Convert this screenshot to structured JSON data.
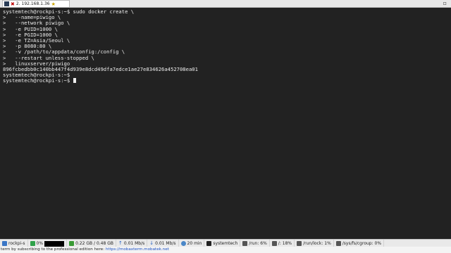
{
  "tab": {
    "label": "2. 192.168.1.36",
    "close_glyph": "✖",
    "star_glyph": "★",
    "window_glyph": "▫"
  },
  "terminal": {
    "lines": [
      "systemtech@rockpi-s:~$ sudo docker create \\",
      ">   --name=piwigo \\",
      ">   --network piwigo \\",
      ">   -e PUID=1000 \\",
      ">   -e PGID=1000 \\",
      ">   -e TZ=Asia/Seoul \\",
      ">   -p 8080:80 \\",
      ">   -v /path/to/appdata/config:/config \\",
      ">   --restart unless-stopped \\",
      ">   linuxserver/piwigo",
      "896fcbedbb0c140bb447f4d939e8dcd49dfa7edce1ae27e834626a452708ea01",
      "systemtech@rockpi-s:~$",
      "systemtech@rockpi-s:~$ "
    ]
  },
  "statusbar": {
    "host": "rockpi-s",
    "cpu": "0%",
    "memory": "0.22 GB / 0.48 GB",
    "upload": "0.01 Mb/s",
    "download": "0.01 Mb/s",
    "uptime": "20 min",
    "user": "systemtech",
    "run": "/run: 6%",
    "root": "/: 18%",
    "runlock": "/run/lock: 1%",
    "cgroup": "/sys/fs/cgroup: 0%"
  },
  "adbar": {
    "text": "term by subscribing to the professional edition here:",
    "link": "https://mobaxterm.mobatek.net"
  }
}
